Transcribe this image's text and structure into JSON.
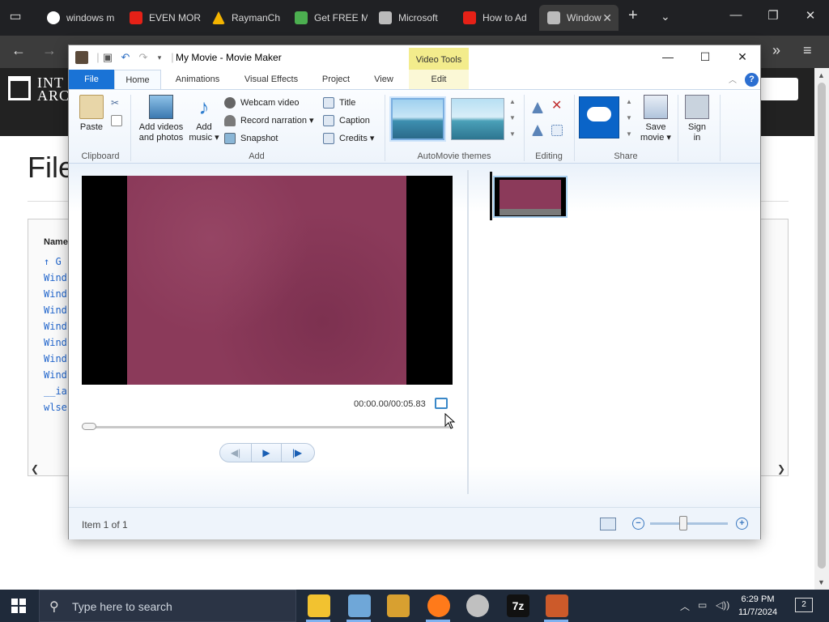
{
  "browser": {
    "tabs": [
      {
        "label": "windows m",
        "icon": "google-icon",
        "color": "#ffffff"
      },
      {
        "label": "EVEN MOR",
        "icon": "youtube-icon",
        "color": "#e62117"
      },
      {
        "label": "RaymanCh",
        "icon": "drive-icon",
        "color": "#f4b400"
      },
      {
        "label": "Get FREE M",
        "icon": "p-icon",
        "color": "#4caf50"
      },
      {
        "label": "Microsoft",
        "icon": "archive-icon",
        "color": "#bbbbbb"
      },
      {
        "label": "How to Ad",
        "icon": "youtube-icon",
        "color": "#e62117"
      },
      {
        "label": "Window",
        "icon": "archive-icon",
        "color": "#bbbbbb"
      }
    ],
    "close_tab": "✕",
    "new_tab": "+",
    "tab_list": "⌄"
  },
  "site": {
    "logo_line1": "INT",
    "logo_line2": "ARC",
    "page_title": "File",
    "column_header": "Name",
    "links": [
      "↑ G",
      "Wind",
      "Wind",
      "Wind",
      "Wind",
      "Wind",
      "Wind",
      "Wind",
      "__ia",
      "wlse"
    ]
  },
  "moviemaker": {
    "title": "My Movie - Movie Maker",
    "context_tab_group": "Video Tools",
    "tabs": {
      "file": "File",
      "home": "Home",
      "animations": "Animations",
      "visual_effects": "Visual Effects",
      "project": "Project",
      "view": "View",
      "edit": "Edit"
    },
    "clipboard": {
      "paste": "Paste",
      "group": "Clipboard"
    },
    "add": {
      "add_videos_line1": "Add videos",
      "add_videos_line2": "and photos",
      "add_music_line1": "Add",
      "add_music_line2": "music ▾",
      "webcam_video": "Webcam video",
      "record_narration": "Record narration ▾",
      "snapshot": "Snapshot",
      "title": "Title",
      "caption": "Caption",
      "credits": "Credits ▾",
      "group": "Add"
    },
    "themes": {
      "group": "AutoMovie themes"
    },
    "editing": {
      "group": "Editing"
    },
    "share": {
      "save_movie_line1": "Save",
      "save_movie_line2": "movie ▾",
      "sign_in_line1": "Sign",
      "sign_in_line2": "in",
      "group": "Share"
    },
    "preview": {
      "time": "00:00.00/00:05.83"
    },
    "status": {
      "item": "Item 1 of 1"
    }
  },
  "taskbar": {
    "search_placeholder": "Type here to search",
    "time": "6:29 PM",
    "date": "11/7/2024",
    "notification_count": "2",
    "apps": [
      {
        "name": "file-explorer",
        "glyph": "",
        "color": "#f2c230"
      },
      {
        "name": "paint",
        "glyph": "",
        "color": "#6fa7d8"
      },
      {
        "name": "media",
        "glyph": "",
        "color": "#d8a030"
      },
      {
        "name": "firefox",
        "glyph": "",
        "color": "#ff7a1a"
      },
      {
        "name": "movie",
        "glyph": "",
        "color": "#c0c0c0"
      },
      {
        "name": "7zip",
        "glyph": "7z",
        "color": "#111111"
      },
      {
        "name": "moviemaker",
        "glyph": "",
        "color": "#cc5a2a"
      }
    ]
  }
}
